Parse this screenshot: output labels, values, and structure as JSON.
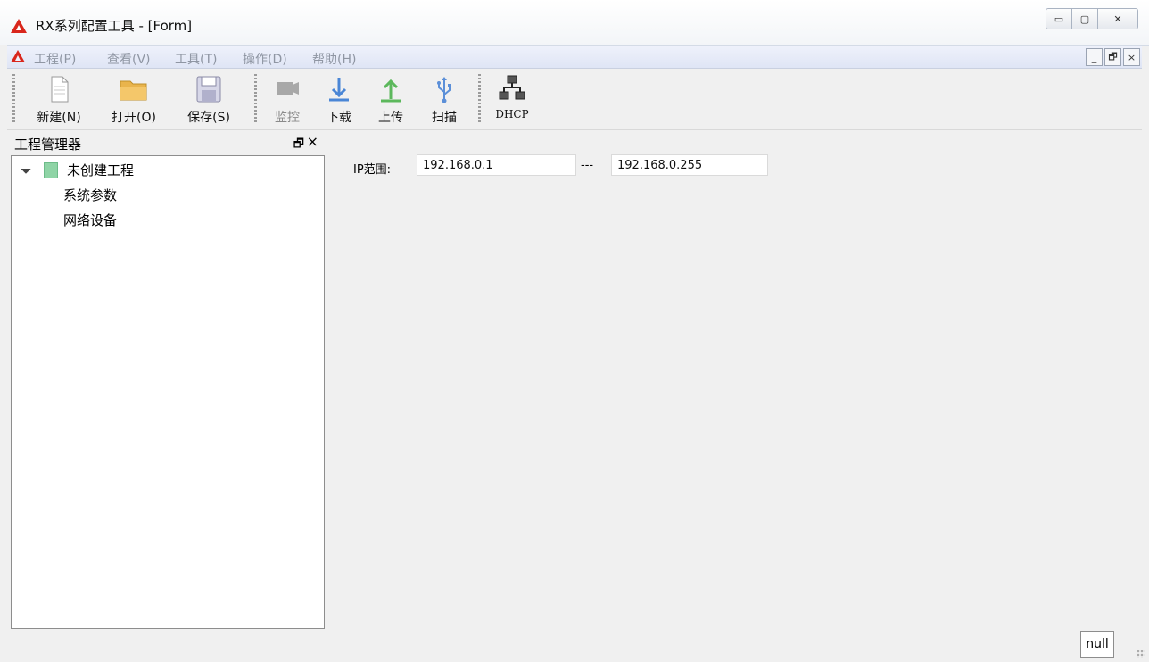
{
  "window": {
    "title": "RX系列配置工具 - [Form]",
    "controls": {
      "minimize": "▭",
      "maximize": "▢",
      "close": "✕"
    }
  },
  "menu": {
    "items": [
      "工程(P)",
      "查看(V)",
      "工具(T)",
      "操作(D)",
      "帮助(H)"
    ],
    "mdi_controls": {
      "minimize": "_",
      "restore": "🗗",
      "close": "×"
    }
  },
  "toolbar": {
    "new_label": "新建(N)",
    "open_label": "打开(O)",
    "save_label": "保存(S)",
    "monitor_label": "监控",
    "download_label": "下载",
    "upload_label": "上传",
    "scan_label": "扫描",
    "dhcp_label": "DHCP"
  },
  "project_panel": {
    "title": "工程管理器",
    "dock_icon": "🗗",
    "close_icon": "×",
    "tree": {
      "root": "未创建工程",
      "children": [
        "系统参数",
        "网络设备"
      ]
    }
  },
  "main": {
    "ip_range_label": "IP范围:",
    "ip_start": "192.168.0.1",
    "separator": "---",
    "ip_end": "192.168.0.255"
  },
  "status": {
    "value": "null"
  },
  "icons": {
    "app": "alert-triangle-icon",
    "new": "new-document-icon",
    "open": "folder-icon",
    "save": "floppy-disk-icon",
    "monitor": "camera-icon",
    "download": "download-arrow-icon",
    "upload": "upload-arrow-icon",
    "scan": "usb-icon",
    "dhcp": "network-icon"
  },
  "colors": {
    "brand_red": "#d9261c",
    "download_blue": "#4a86d6",
    "upload_green": "#5cb85c",
    "tree_icon_green": "#8fd4a6"
  }
}
